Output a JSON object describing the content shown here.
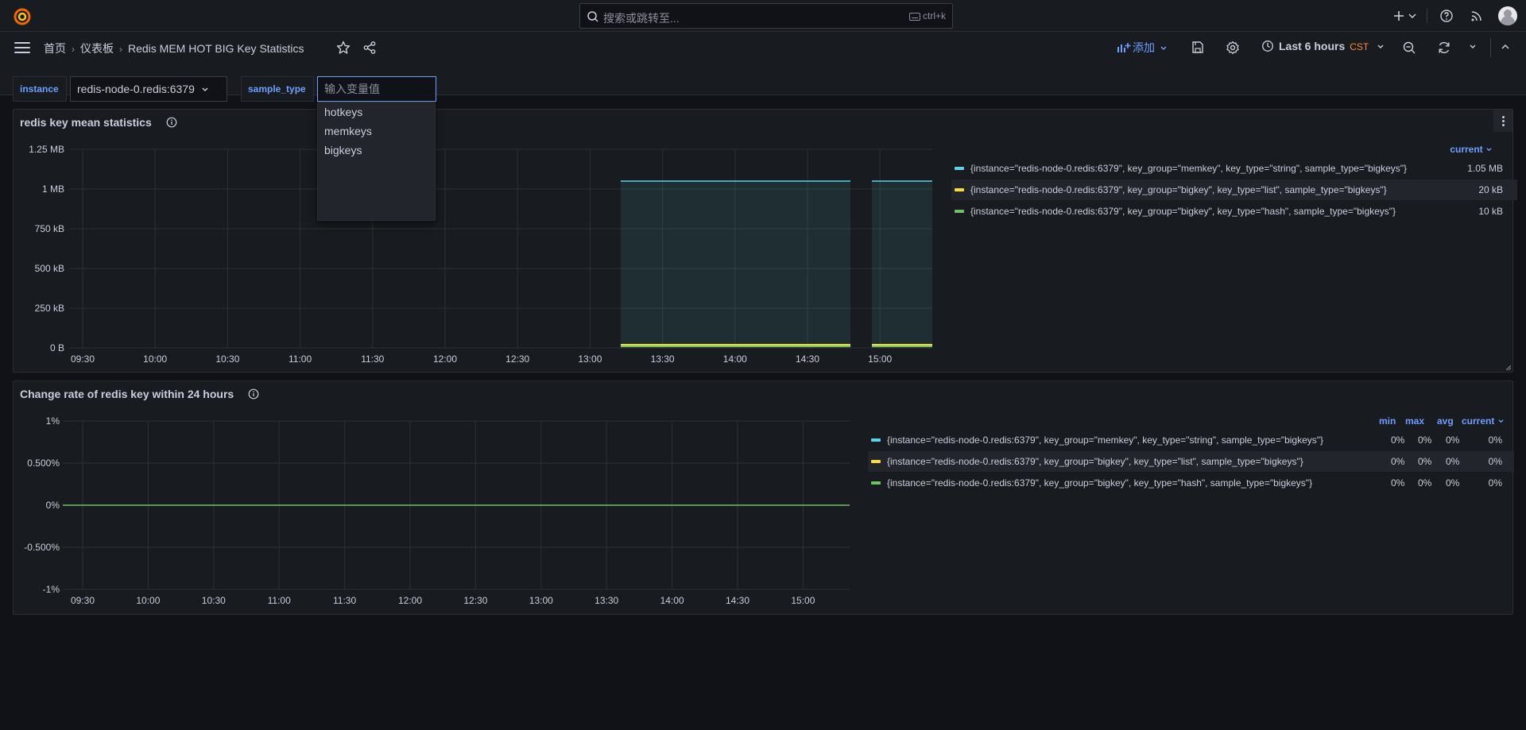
{
  "search": {
    "placeholder": "搜索或跳转至...",
    "shortcut": "ctrl+k"
  },
  "breadcrumb": {
    "home": "首页",
    "dashboards": "仪表板",
    "current": "Redis MEM HOT BIG Key Statistics"
  },
  "toolbar": {
    "add_label": "添加",
    "time_range": "Last 6 hours",
    "timezone": "CST"
  },
  "variables": {
    "instance": {
      "label": "instance",
      "value": "redis-node-0.redis:6379"
    },
    "sample_type": {
      "label": "sample_type",
      "placeholder": "输入变量值",
      "options": [
        "hotkeys",
        "memkeys",
        "bigkeys"
      ]
    }
  },
  "colors": {
    "accent": "#6e9fff",
    "series1": "#73bf69",
    "series0": "#8ab8ff",
    "series_cyan": "#5ad4e6",
    "series_yellow": "#fade2a",
    "series_green": "#73bf69",
    "timezone": "#ff8833"
  },
  "panel1": {
    "title": "redis key mean statistics",
    "legend_header": "current",
    "y_ticks": [
      "1.25 MB",
      "1 MB",
      "750 kB",
      "500 kB",
      "250 kB",
      "0 B"
    ],
    "x_ticks": [
      "09:30",
      "10:00",
      "10:30",
      "11:00",
      "11:30",
      "12:00",
      "12:30",
      "13:00",
      "13:30",
      "14:00",
      "14:30",
      "15:00"
    ],
    "legend": [
      {
        "name": "{instance=\"redis-node-0.redis:6379\", key_group=\"memkey\", key_type=\"string\", sample_type=\"bigkeys\"}",
        "current": "1.05 MB"
      },
      {
        "name": "{instance=\"redis-node-0.redis:6379\", key_group=\"bigkey\", key_type=\"list\", sample_type=\"bigkeys\"}",
        "current": "20 kB"
      },
      {
        "name": "{instance=\"redis-node-0.redis:6379\", key_group=\"bigkey\", key_type=\"hash\", sample_type=\"bigkeys\"}",
        "current": "10 kB"
      }
    ]
  },
  "panel2": {
    "title": "Change rate of redis key within 24 hours",
    "legend_headers": {
      "min": "min",
      "max": "max",
      "avg": "avg",
      "current": "current"
    },
    "y_ticks": [
      "1%",
      "0.500%",
      "0%",
      "-0.500%",
      "-1%"
    ],
    "x_ticks": [
      "09:30",
      "10:00",
      "10:30",
      "11:00",
      "11:30",
      "12:00",
      "12:30",
      "13:00",
      "13:30",
      "14:00",
      "14:30",
      "15:00"
    ],
    "legend": [
      {
        "name": "{instance=\"redis-node-0.redis:6379\", key_group=\"memkey\", key_type=\"string\", sample_type=\"bigkeys\"}",
        "min": "0%",
        "max": "0%",
        "avg": "0%",
        "current": "0%"
      },
      {
        "name": "{instance=\"redis-node-0.redis:6379\", key_group=\"bigkey\", key_type=\"list\", sample_type=\"bigkeys\"}",
        "min": "0%",
        "max": "0%",
        "avg": "0%",
        "current": "0%"
      },
      {
        "name": "{instance=\"redis-node-0.redis:6379\", key_group=\"bigkey\", key_type=\"hash\", sample_type=\"bigkeys\"}",
        "min": "0%",
        "max": "0%",
        "avg": "0%",
        "current": "0%"
      }
    ]
  }
}
